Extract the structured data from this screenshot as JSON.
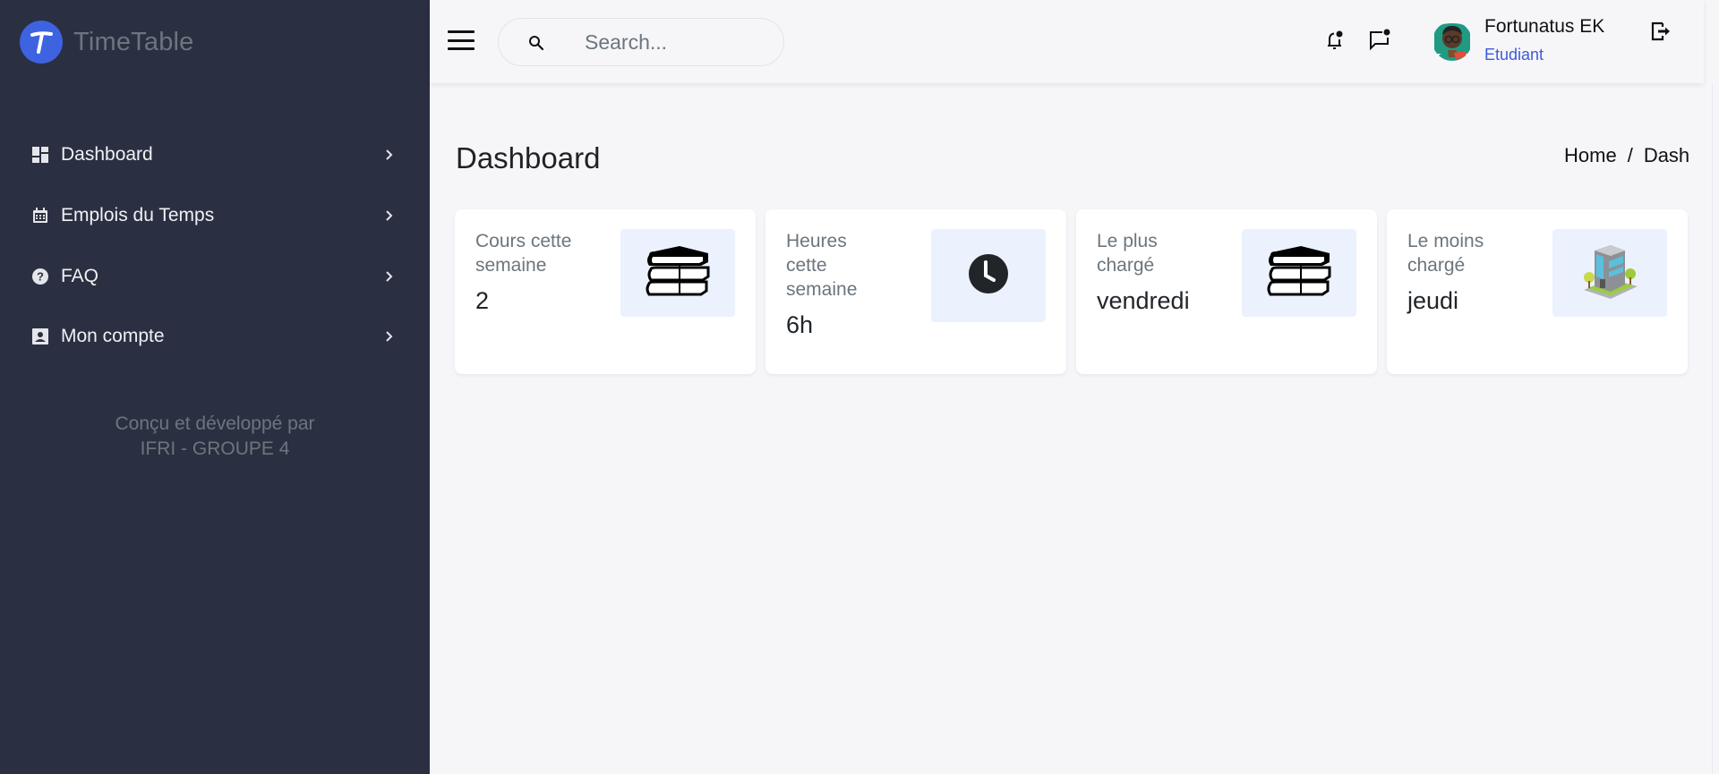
{
  "brand": {
    "name": "TimeTable",
    "logo_letter": "T",
    "logo_color": "#3d63e0"
  },
  "sidebar": {
    "items": [
      {
        "label": "Dashboard",
        "icon": "dashboard-icon"
      },
      {
        "label": "Emplois du Temps",
        "icon": "calendar-icon"
      },
      {
        "label": "FAQ",
        "icon": "help-icon"
      },
      {
        "label": "Mon compte",
        "icon": "account-icon"
      }
    ],
    "credits_line1": "Conçu et développé par",
    "credits_line2": "IFRI - GROUPE 4"
  },
  "header": {
    "search_placeholder": "Search...",
    "search_value": "",
    "user": {
      "name": "Fortunatus EK",
      "role": "Etudiant"
    }
  },
  "page": {
    "title": "Dashboard",
    "breadcrumb": [
      "Home",
      "/",
      "Dash"
    ]
  },
  "cards": [
    {
      "label": "Cours cette semaine",
      "value": "2",
      "icon": "books-icon"
    },
    {
      "label": "Heures cette semaine",
      "value": "6h",
      "icon": "clock-icon"
    },
    {
      "label": "Le plus chargé",
      "value": "vendredi",
      "icon": "books-icon"
    },
    {
      "label": "Le moins chargé",
      "value": "jeudi",
      "icon": "building-icon"
    }
  ],
  "colors": {
    "sidebar_bg": "#2a3042",
    "page_bg": "#f6f6f9",
    "accent": "#3d5bd9",
    "icon_box_bg": "#ebf2fe"
  }
}
